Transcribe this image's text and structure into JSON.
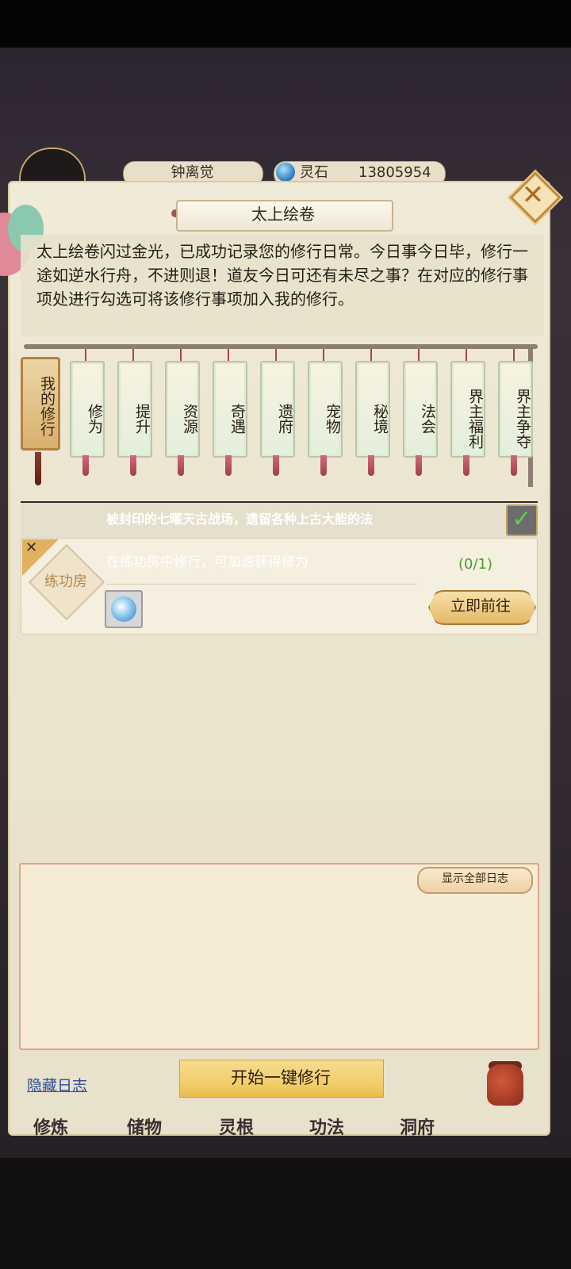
{
  "topbar": {
    "player_name": "钟离觉",
    "stone_label": "灵石",
    "stone_value": "13805954"
  },
  "panel": {
    "title": "太上绘卷",
    "intro": "太上绘卷闪过金光，已成功记录您的修行日常。今日事今日毕，修行一途如逆水行舟，不进则退！道友今日可还有未尽之事？在对应的修行事项处进行勾选可将该修行事项加入我的修行。",
    "close_icon": "close-icon"
  },
  "categories": {
    "active": "我的修行",
    "items": [
      "修为",
      "提升",
      "资源",
      "奇遇",
      "遗府",
      "宠物",
      "秘境",
      "法会",
      "界主福利",
      "界主争夺"
    ]
  },
  "tasks": {
    "dimmed_text": "被封印的七曜天古战场，遗留各种上古大能的法",
    "card": {
      "badge": "练功房",
      "description": "在练功房中修行，可加速获得修为",
      "progress": "(0/1)",
      "go_label": "立即前往"
    }
  },
  "log": {
    "show_all_label": "显示全部日志"
  },
  "footer": {
    "hide_log_label": "隐藏日志",
    "start_label": "开始一键修行"
  },
  "bottom_nav": [
    "修炼",
    "储物",
    "灵根",
    "功法",
    "洞府"
  ]
}
